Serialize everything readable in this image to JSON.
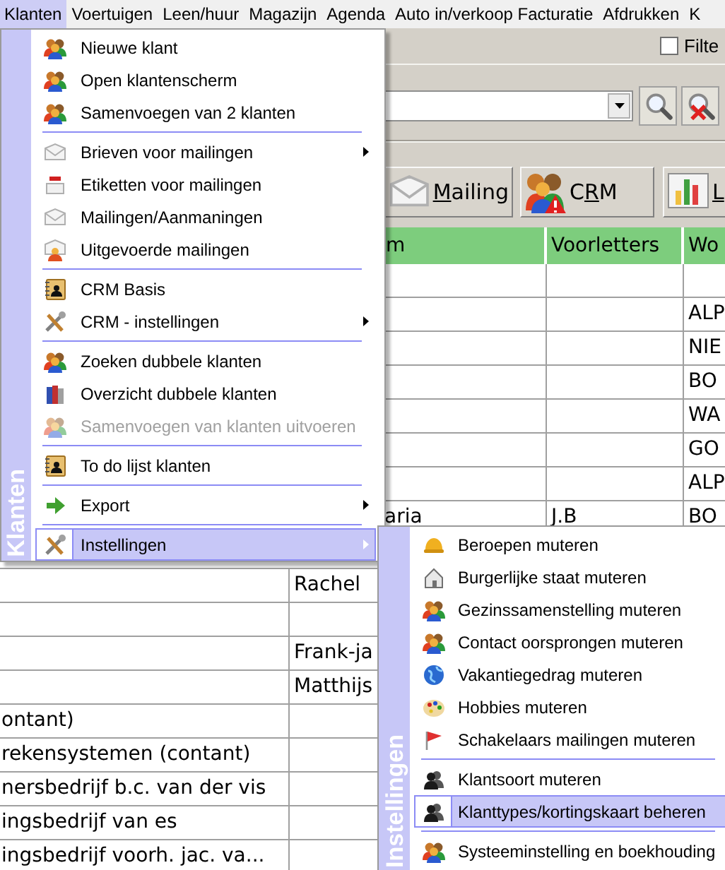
{
  "menubar": [
    {
      "label": "Klanten",
      "selected": true
    },
    {
      "label": "Voertuigen",
      "selected": false
    },
    {
      "label": "Leen/huur",
      "selected": false
    },
    {
      "label": "Magazijn",
      "selected": false
    },
    {
      "label": "Agenda",
      "selected": false
    },
    {
      "label": "Auto in/verkoop Facturatie",
      "selected": false
    },
    {
      "label": "Afdrukken",
      "selected": false
    },
    {
      "label": "K",
      "selected": false
    }
  ],
  "filter": {
    "label": "Filte",
    "checked": false
  },
  "toolbar": [
    {
      "kind": "envelope",
      "key": "M",
      "after": "ailing"
    },
    {
      "kind": "crm",
      "before": "C",
      "key": "R",
      "after": "M"
    },
    {
      "kind": "chart",
      "key": "L"
    }
  ],
  "table": {
    "columns": [
      {
        "label": "m"
      },
      {
        "label": "Voorletters"
      },
      {
        "label": "Wo"
      }
    ],
    "rows_top": [
      {
        "kind": "blank"
      },
      {
        "column_4": "ALP"
      },
      {
        "column_4": "NIE"
      },
      {
        "column_4": "BO"
      },
      {
        "column_4": "WA"
      },
      {
        "column_4": "GO"
      },
      {
        "column_4": "ALP"
      },
      {
        "column_2": "aria",
        "voorletters": "J.B",
        "column_4": "BO"
      }
    ],
    "rows_bottom": [
      {
        "column_2": "Rachel"
      },
      {
        "kind": "blank"
      },
      {
        "column_2": "Frank-ja"
      },
      {
        "column_2": "Matthijs"
      },
      {
        "column_1": "ontant)"
      },
      {
        "column_1": "rekensystemen (contant)"
      },
      {
        "column_1": "nersbedrijf b.c. van der vis"
      },
      {
        "column_1": "ingsbedrijf van es"
      },
      {
        "column_1": "ingsbedrijf voorh. jac. va..."
      }
    ]
  },
  "menu": {
    "title": "Klanten",
    "items": [
      {
        "kind": "people",
        "label": "Nieuwe klant",
        "disabled": false,
        "submenu": false,
        "selected": false
      },
      {
        "kind": "people",
        "label": "Open klantenscherm",
        "disabled": false,
        "submenu": false,
        "selected": false
      },
      {
        "kind": "people",
        "label": "Samenvoegen van 2 klanten",
        "disabled": false,
        "submenu": false,
        "selected": false
      },
      {
        "kind": "separator"
      },
      {
        "kind": "envelope",
        "label": "Brieven voor mailingen",
        "disabled": false,
        "submenu": true,
        "selected": false
      },
      {
        "kind": "label",
        "label": "Etiketten voor mailingen",
        "disabled": false,
        "submenu": false,
        "selected": false
      },
      {
        "kind": "envelope",
        "label": "Mailingen/Aanmaningen",
        "disabled": false,
        "submenu": false,
        "selected": false
      },
      {
        "kind": "mailpeople",
        "label": "Uitgevoerde mailingen",
        "disabled": false,
        "submenu": false,
        "selected": false
      },
      {
        "kind": "separator"
      },
      {
        "kind": "card",
        "label": "CRM Basis",
        "disabled": false,
        "submenu": false,
        "selected": false
      },
      {
        "kind": "tools",
        "label": "CRM - instellingen",
        "disabled": false,
        "submenu": true,
        "selected": false
      },
      {
        "kind": "separator"
      },
      {
        "kind": "people",
        "label": "Zoeken dubbele klanten",
        "disabled": false,
        "submenu": false,
        "selected": false
      },
      {
        "kind": "books",
        "label": "Overzicht dubbele klanten",
        "disabled": false,
        "submenu": false,
        "selected": false
      },
      {
        "kind": "people",
        "label": "Samenvoegen van klanten uitvoeren",
        "disabled": true,
        "submenu": false,
        "selected": false
      },
      {
        "kind": "separator"
      },
      {
        "kind": "card",
        "label": "To do lijst klanten",
        "disabled": false,
        "submenu": false,
        "selected": false
      },
      {
        "kind": "separator"
      },
      {
        "kind": "arrow",
        "label": "Export",
        "disabled": false,
        "submenu": true,
        "selected": false
      },
      {
        "kind": "separator"
      },
      {
        "kind": "tools",
        "label": "Instellingen",
        "disabled": false,
        "submenu": true,
        "selected": true
      }
    ]
  },
  "submenu": {
    "title": "Instellingen",
    "items": [
      {
        "kind": "helmet",
        "label": "Beroepen muteren",
        "selected": false
      },
      {
        "kind": "house",
        "label": "Burgerlijke staat muteren",
        "selected": false
      },
      {
        "kind": "people",
        "label": "Gezinssamenstelling muteren",
        "selected": false
      },
      {
        "kind": "people",
        "label": "Contact oorsprongen muteren",
        "selected": false
      },
      {
        "kind": "globe",
        "label": "Vakantiegedrag muteren",
        "selected": false
      },
      {
        "kind": "palette",
        "label": "Hobbies muteren",
        "selected": false
      },
      {
        "kind": "flag",
        "label": "Schakelaars mailingen muteren",
        "selected": false
      },
      {
        "kind": "separator"
      },
      {
        "kind": "person",
        "label": "Klantsoort muteren",
        "selected": false
      },
      {
        "kind": "person",
        "label": "Klanttypes/kortingskaart beheren",
        "selected": true
      },
      {
        "kind": "separator"
      },
      {
        "kind": "people",
        "label": "Systeeminstelling en boekhouding",
        "selected": false
      }
    ]
  }
}
